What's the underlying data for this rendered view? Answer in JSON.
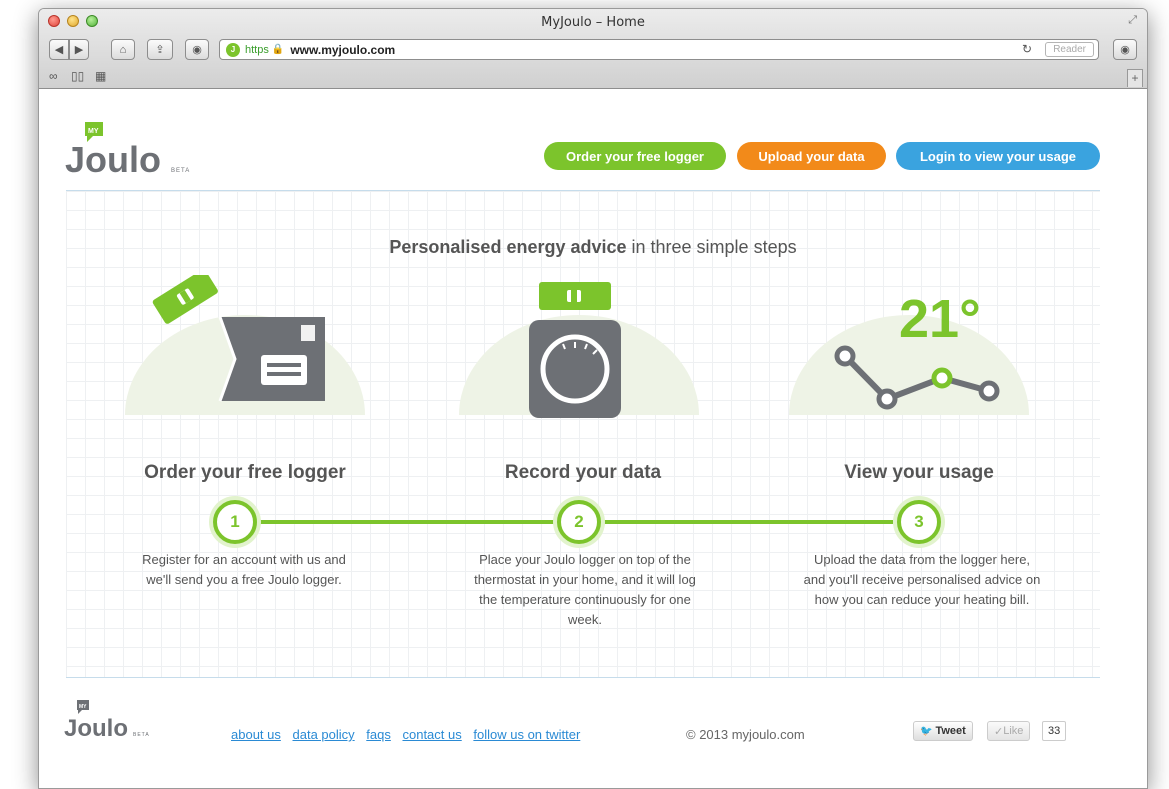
{
  "browser": {
    "title": "MyJoulo – Home",
    "url_https": "https",
    "url": "www.myjoulo.com",
    "reader_label": "Reader"
  },
  "logo": {
    "my": "MY",
    "name": "Joulo",
    "beta": "BETA"
  },
  "header": {
    "order_button": "Order your free logger",
    "upload_button": "Upload your data",
    "login_button": "Login to view your usage"
  },
  "headline": {
    "bold": "Personalised energy advice",
    "rest": " in three simple steps"
  },
  "steps": [
    {
      "number": "1",
      "title": "Order your free logger",
      "text": "Register for an account with us and we'll send you a free Joulo logger."
    },
    {
      "number": "2",
      "title": "Record your data",
      "text": "Place your Joulo logger on top of the thermostat in your home, and it will log the temperature continuously for one week."
    },
    {
      "number": "3",
      "title": "View your usage",
      "text": "Upload the data from the logger here, and you'll receive personalised advice on how you can reduce your heating bill."
    }
  ],
  "temperature_display": "21°",
  "footer": {
    "links": [
      "about us",
      "data policy",
      "faqs",
      "contact us",
      "follow us on twitter"
    ],
    "copyright": "© 2013 myjoulo.com",
    "tweet_label": "Tweet",
    "like_label": "Like",
    "like_count": "33"
  },
  "colors": {
    "green": "#7cc42c",
    "orange": "#f28a1a",
    "blue": "#3aa3df",
    "icon_gray": "#6d7075"
  }
}
